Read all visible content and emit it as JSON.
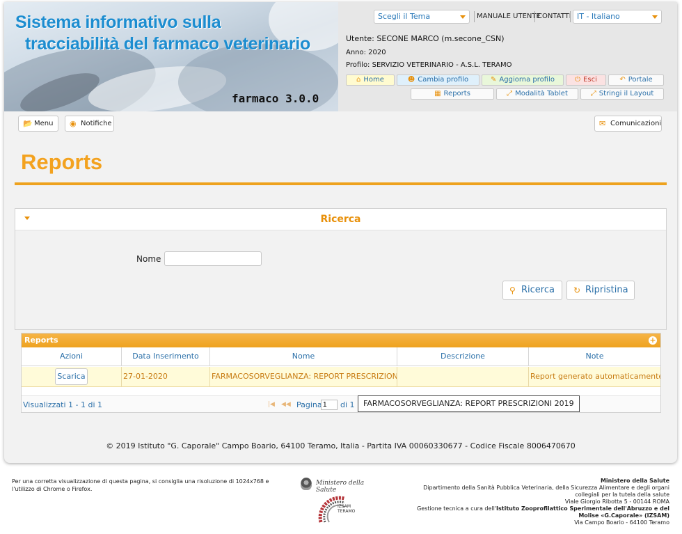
{
  "banner": {
    "title_line1": "Sistema informativo sulla",
    "title_line2": "tracciabilità del farmaco veterinario",
    "version": "farmaco 3.0.0"
  },
  "header": {
    "theme_select": "Scegli il Tema",
    "manual": "MANUALE UTENTE",
    "contacts": "CONTATTI",
    "language_select": "IT - Italiano",
    "user": "Utente: SECONE MARCO (m.secone_CSN)",
    "year": "Anno: 2020",
    "profile": "Profilo: SERVIZIO VETERINARIO - A.S.L. TERAMO",
    "buttons": {
      "home": "Home",
      "cambia_profilo": "Cambia profilo",
      "aggiorna_profilo": "Aggiorna profilo",
      "esci": "Esci",
      "portale": "Portale",
      "reports": "Reports",
      "modalita_tablet": "Modalità Tablet",
      "stringi_layout": "Stringi il Layout"
    }
  },
  "toolbar": {
    "menu": "Menu",
    "notifiche": "Notifiche",
    "comunicazioni": "Comunicazioni"
  },
  "page_title": "Reports",
  "search": {
    "title": "Ricerca",
    "nome_label": "Nome",
    "nome_value": "",
    "btn_ricerca": "Ricerca",
    "btn_ripristina": "Ripristina"
  },
  "grid": {
    "caption": "Reports",
    "columns": [
      "Azioni",
      "Data Inserimento",
      "Nome",
      "Descrizione",
      "Note"
    ],
    "rows": [
      {
        "action": "Scarica",
        "data_inserimento": "27-01-2020",
        "nome": "FARMACOSORVEGLIANZA: REPORT PRESCRIZIONI 2019",
        "descrizione": "",
        "note": "Report generato automaticamente. Mo"
      }
    ],
    "pager_info": "Visualizzati 1 - 1 di 1",
    "page_label": "Pagina",
    "page_value": "1",
    "page_of": "di 1"
  },
  "tooltip": "FARMACOSORVEGLIANZA: REPORT PRESCRIZIONI 2019",
  "footer": {
    "copyright": "© 2019 Istituto \"G. Caporale\" Campo Boario, 64100 Teramo, Italia - Partita IVA 00060330677 - Codice Fiscale 8006470670"
  },
  "outer_footer": {
    "note": "Per una corretta visualizzazione di questa pagina, si consiglia una risoluzione di 1024x768 e l'utilizzo di Chrome o Firefox.",
    "ministry_logo_text": "Ministero della Salute",
    "izsam_logo_line1": "IZSAM",
    "izsam_logo_line2": "TERAMO",
    "right_line1": "Ministero della Salute",
    "right_line2": "Dipartimento della Sanità Pubblica Veterinaria, della Sicurezza Alimentare e degli organi collegiali per la tutela della salute",
    "right_line3": "Viale Giorgio Ribotta 5 - 00144 ROMA",
    "right_line4_prefix": "Gestione tecnica a cura dell'",
    "right_line4_bold": "Istituto Zooprofilattico Sperimentale dell'Abruzzo e del Molise «G.Caporale» (IZSAM)",
    "right_line5": "Via Campo Boario - 64100 Teramo"
  },
  "colors": {
    "accent_orange": "#eea21e",
    "title_blue": "#1c8dd0",
    "link_blue": "#2a6fa8",
    "row_highlight": "#fffbd9"
  }
}
